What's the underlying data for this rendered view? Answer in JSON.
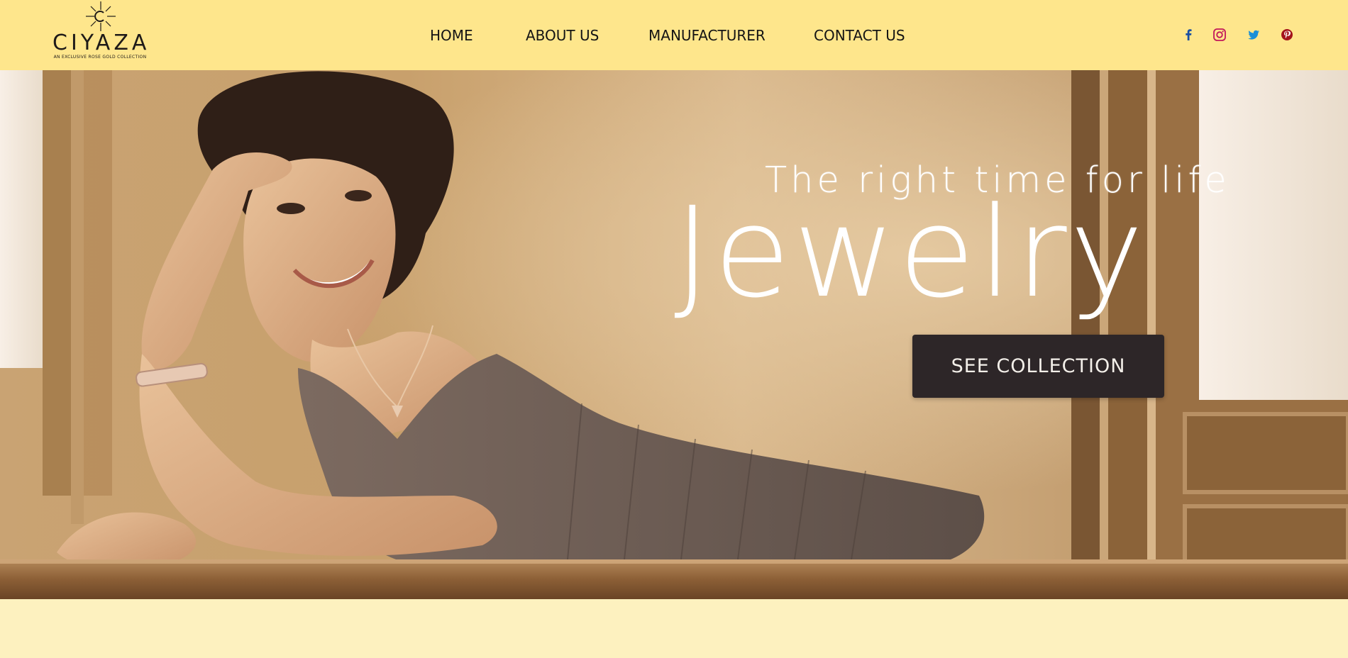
{
  "brand": {
    "name": "CIYAZA",
    "tagline": "AN EXCLUSIVE ROSE GOLD COLLECTION",
    "icon": "sun-star-logo"
  },
  "nav": {
    "items": [
      {
        "label": "HOME"
      },
      {
        "label": "ABOUT US"
      },
      {
        "label": "MANUFACTURER"
      },
      {
        "label": "CONTACT US"
      }
    ]
  },
  "social": [
    {
      "icon": "facebook-icon",
      "color": "#1a4fa3"
    },
    {
      "icon": "instagram-icon",
      "color": "#c2185b"
    },
    {
      "icon": "twitter-icon",
      "color": "#1a8fd8"
    },
    {
      "icon": "pinterest-icon",
      "color": "#a3141b"
    }
  ],
  "hero": {
    "subtitle": "The right time for life",
    "title": "Jewelry",
    "cta_label": "SEE COLLECTION",
    "image": "woman-wearing-rose-gold-jewelry-photo"
  },
  "colors": {
    "header_bg": "#fee68c",
    "page_bg": "#fdf1bf",
    "cta_bg": "#2d2628"
  }
}
